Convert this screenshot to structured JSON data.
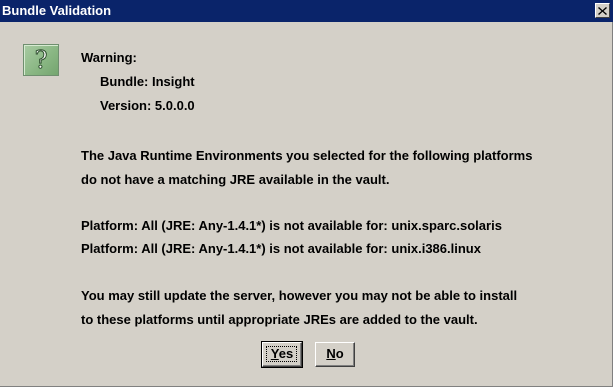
{
  "window": {
    "title": "Bundle Validation",
    "close_glyph": "×"
  },
  "icon": {
    "name": "question-mark-icon",
    "glyph": "?",
    "color": "#8ab784"
  },
  "header": {
    "warning": "Warning:",
    "bundle": "Bundle: Insight",
    "version": "Version: 5.0.0.0"
  },
  "message": {
    "line1": "The Java Runtime Environments you selected for the following platforms",
    "line2": "do not have a matching JRE available in the vault."
  },
  "platforms": [
    "Platform: All (JRE: Any-1.4.1*) is not available for: unix.sparc.solaris",
    "Platform: All (JRE: Any-1.4.1*) is not available for: unix.i386.linux"
  ],
  "note": {
    "line1": "You may still update the server, however you may not be able to install",
    "line2": "to these platforms until appropriate JREs are added to the vault."
  },
  "buttons": {
    "yes": {
      "mnemonic": "Y",
      "rest": "es"
    },
    "no": {
      "mnemonic": "N",
      "rest": "o"
    }
  },
  "colors": {
    "titlebar": "#0a246a",
    "dialog_bg": "#d4d0c8"
  }
}
